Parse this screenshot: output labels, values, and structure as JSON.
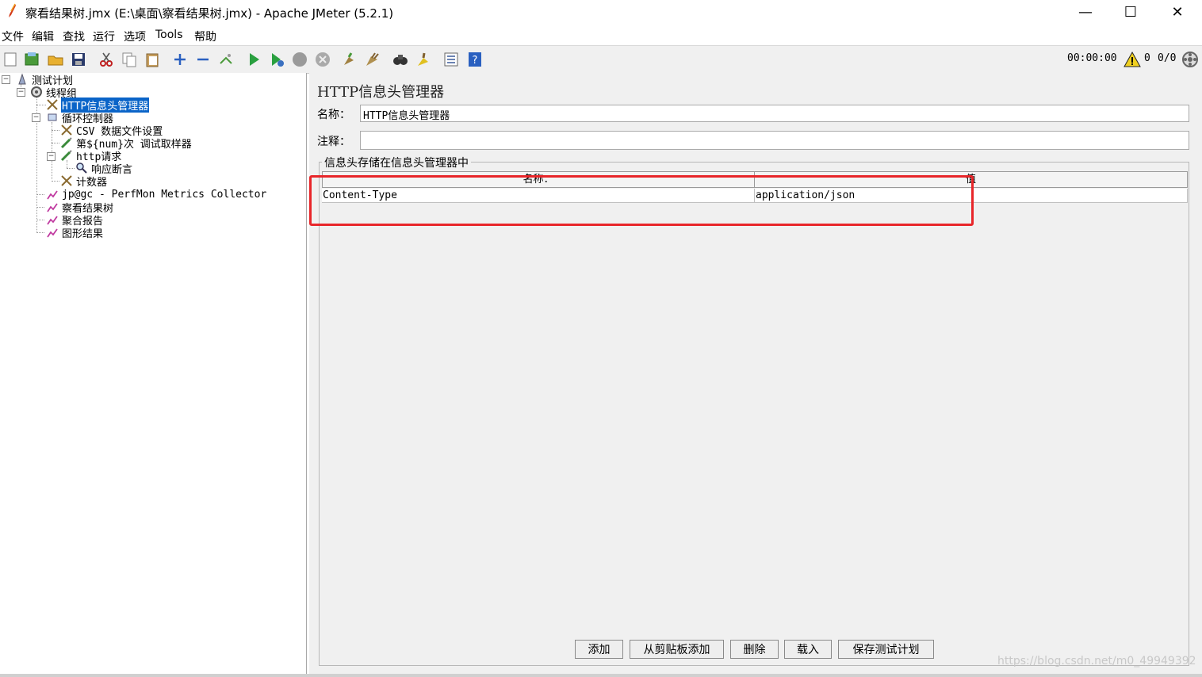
{
  "window": {
    "title": "察看结果树.jmx (E:\\桌面\\察看结果树.jmx) - Apache JMeter (5.2.1)",
    "minimize": "—",
    "maximize": "☐",
    "close": "✕"
  },
  "menu": [
    "文件",
    "编辑",
    "查找",
    "运行",
    "选项",
    "Tools",
    "帮助"
  ],
  "toolbar": {
    "icons": [
      "new-icon",
      "templates-icon",
      "open-icon",
      "save-icon",
      "cut-icon",
      "copy-icon",
      "paste-icon",
      "expand-icon",
      "collapse-icon",
      "toggle-icon",
      "start-icon",
      "start-no-pause-icon",
      "stop-icon",
      "shutdown-icon",
      "clear-icon",
      "clear-all-icon",
      "search-icon",
      "reset-search-icon",
      "function-helper-icon",
      "help-icon"
    ],
    "timer": "00:00:00",
    "warnings": "0",
    "threads": "0/0"
  },
  "tree": {
    "nodes": [
      {
        "label": "测试计划",
        "icon": "test-plan-icon"
      },
      {
        "label": "线程组",
        "icon": "thread-group-icon"
      },
      {
        "label": "HTTP信息头管理器",
        "icon": "config-icon",
        "selected": true
      },
      {
        "label": "循环控制器",
        "icon": "controller-icon"
      },
      {
        "label": "CSV 数据文件设置",
        "icon": "config-icon"
      },
      {
        "label": "第${num}次 调试取样器",
        "icon": "sampler-icon"
      },
      {
        "label": "http请求",
        "icon": "sampler-icon"
      },
      {
        "label": "响应断言",
        "icon": "assertion-icon"
      },
      {
        "label": "计数器",
        "icon": "config-icon"
      },
      {
        "label": "jp@gc - PerfMon Metrics Collector",
        "icon": "listener-icon"
      },
      {
        "label": "察看结果树",
        "icon": "listener-icon"
      },
      {
        "label": "聚合报告",
        "icon": "listener-icon"
      },
      {
        "label": "图形结果",
        "icon": "listener-icon"
      }
    ]
  },
  "panel": {
    "title": "HTTP信息头管理器",
    "name_label": "名称：",
    "name_value": "HTTP信息头管理器",
    "comment_label": "注释：",
    "comment_value": "",
    "group_title": "信息头存储在信息头管理器中",
    "table": {
      "columns": [
        "名称：",
        "值"
      ],
      "rows": [
        [
          "Content-Type",
          "application/json"
        ]
      ]
    },
    "buttons": [
      "添加",
      "从剪贴板添加",
      "删除",
      "载入",
      "保存测试计划"
    ],
    "watermark": "https://blog.csdn.net/m0_49949392"
  },
  "colors": {
    "selection": "#0a64c8",
    "highlight_box": "#e8262a"
  }
}
